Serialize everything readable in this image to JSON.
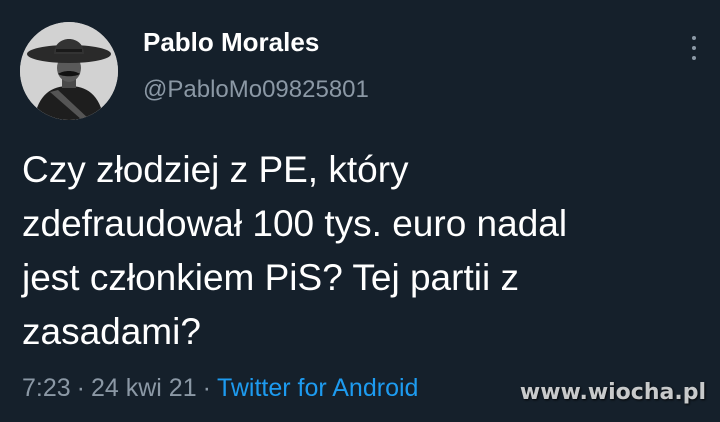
{
  "tweet": {
    "author": {
      "display_name": "Pablo Morales",
      "handle": "@PabloMo09825801"
    },
    "text": "Czy złodziej z PE, który\nzdefraudował 100 tys. euro nadal\njest członkiem PiS? Tej partii z\nzasadami?",
    "time": "7:23",
    "separator": "·",
    "date": "24 kwi 21",
    "source": "Twitter for Android"
  },
  "watermark": "www.wiocha.pl",
  "colors": {
    "background": "#15202b",
    "text": "#ffffff",
    "secondary": "#8b98a5",
    "link": "#1d9bf0"
  },
  "icons": {
    "more": "vertical-ellipsis-icon",
    "avatar": "sombrero-man-portrait"
  }
}
